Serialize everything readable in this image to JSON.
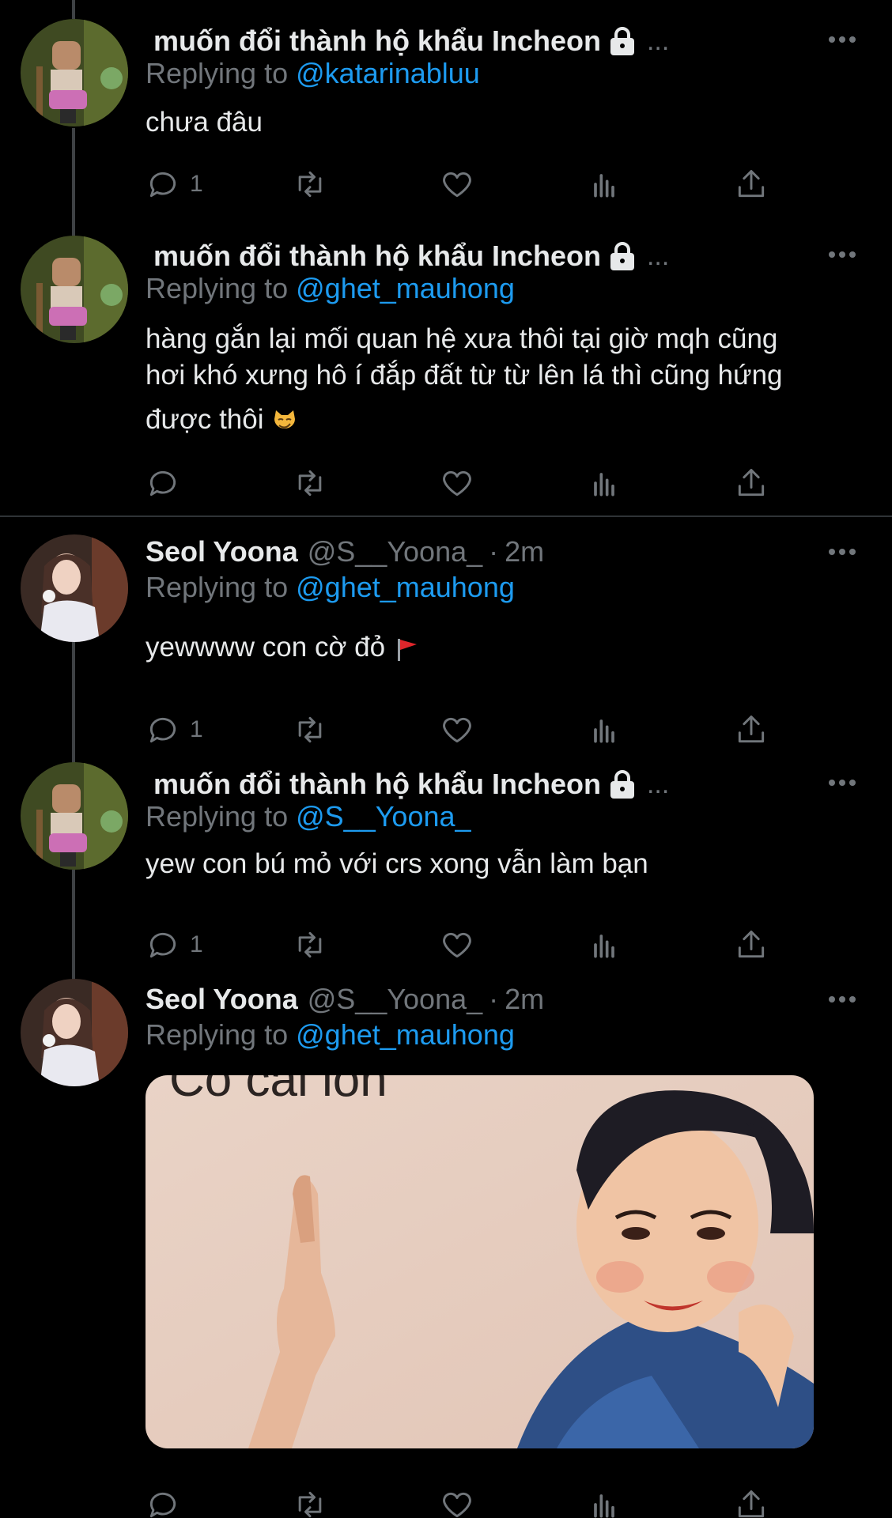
{
  "tweets": [
    {
      "name": "muốn đổi thành hộ khẩu Incheon",
      "trailing": "...",
      "replying_prefix": "Replying to",
      "replying_to": "@katarinabluu",
      "text": "chưa đâu",
      "reply_count": "1"
    },
    {
      "name": "muốn đổi thành hộ khẩu Incheon",
      "trailing": "...",
      "replying_prefix": "Replying to",
      "replying_to": "@ghet_mauhong",
      "text_line1": "hàng gắn lại mối quan hệ xưa thôi tại giờ mqh cũng",
      "text_line2": "hơi khó xưng hô í đắp đất từ từ lên lá thì cũng hứng",
      "text_line3": "được thôi",
      "emoji": "smirk-cat"
    },
    {
      "name": "Seol Yoona",
      "handle": "@S__Yoona_",
      "dot": "·",
      "time": "2m",
      "replying_prefix": "Replying to",
      "replying_to": "@ghet_mauhong",
      "text": "yewwww con cờ đỏ",
      "emoji": "red-flag",
      "reply_count": "1"
    },
    {
      "name": "muốn đổi thành hộ khẩu Incheon",
      "trailing": "...",
      "replying_prefix": "Replying to",
      "replying_to": "@S__Yoona_",
      "text": "yew con bú mỏ với crs xong vẫn làm bạn",
      "reply_count": "1"
    },
    {
      "name": "Seol Yoona",
      "handle": "@S__Yoona_",
      "dot": "·",
      "time": "2m",
      "replying_prefix": "Replying to",
      "replying_to": "@ghet_mauhong",
      "media_caption": "Có cái lồn"
    }
  ],
  "colors": {
    "background": "#000000",
    "text": "#e7e9ea",
    "muted": "#71767b",
    "accent": "#1d9bf0",
    "thread_line": "#3e4144"
  }
}
